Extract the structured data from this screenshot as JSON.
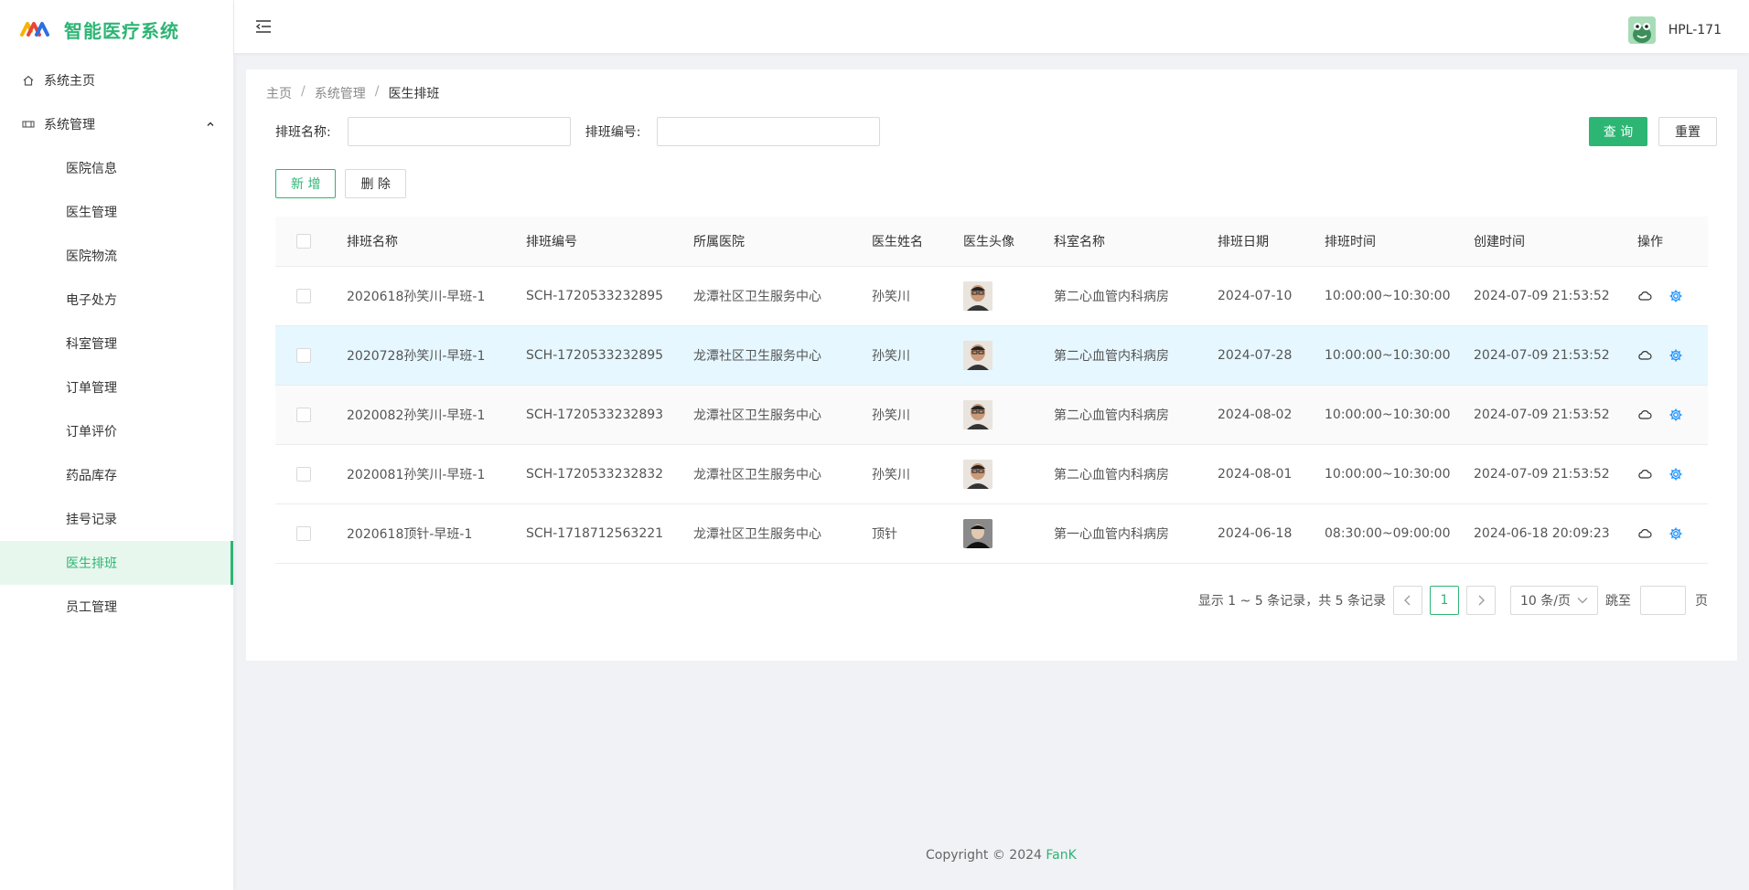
{
  "app": {
    "title": "智能医疗系统"
  },
  "sidebar": {
    "home": "系统主页",
    "group": "系统管理",
    "items": [
      {
        "label": "医院信息"
      },
      {
        "label": "医生管理"
      },
      {
        "label": "医院物流"
      },
      {
        "label": "电子处方"
      },
      {
        "label": "科室管理"
      },
      {
        "label": "订单管理"
      },
      {
        "label": "订单评价"
      },
      {
        "label": "药品库存"
      },
      {
        "label": "挂号记录"
      },
      {
        "label": "医生排班"
      },
      {
        "label": "员工管理"
      }
    ],
    "active": "医生排班"
  },
  "header": {
    "username": "HPL-171"
  },
  "breadcrumb": {
    "home": "主页",
    "section": "系统管理",
    "current": "医生排班",
    "sep": "/"
  },
  "search": {
    "name_label": "排班名称:",
    "code_label": "排班编号:",
    "name_value": "",
    "code_value": "",
    "query_btn": "查 询",
    "reset_btn": "重置"
  },
  "toolbar": {
    "add_btn": "新 增",
    "delete_btn": "删 除"
  },
  "table": {
    "columns": [
      "排班名称",
      "排班编号",
      "所属医院",
      "医生姓名",
      "医生头像",
      "科室名称",
      "排班日期",
      "排班时间",
      "创建时间",
      "操作"
    ],
    "rows": [
      {
        "name": "2020618孙笑川-早班-1",
        "code": "SCH-1720533232895",
        "hospital": "龙潭社区卫生服务中心",
        "doctor": "孙笑川",
        "dept": "第二心血管内科病房",
        "date": "2024-07-10",
        "time": "10:00:00~10:30:00",
        "created": "2024-07-09 21:53:52"
      },
      {
        "name": "2020728孙笑川-早班-1",
        "code": "SCH-1720533232895",
        "hospital": "龙潭社区卫生服务中心",
        "doctor": "孙笑川",
        "dept": "第二心血管内科病房",
        "date": "2024-07-28",
        "time": "10:00:00~10:30:00",
        "created": "2024-07-09 21:53:52"
      },
      {
        "name": "2020082孙笑川-早班-1",
        "code": "SCH-1720533232893",
        "hospital": "龙潭社区卫生服务中心",
        "doctor": "孙笑川",
        "dept": "第二心血管内科病房",
        "date": "2024-08-02",
        "time": "10:00:00~10:30:00",
        "created": "2024-07-09 21:53:52"
      },
      {
        "name": "2020081孙笑川-早班-1",
        "code": "SCH-1720533232832",
        "hospital": "龙潭社区卫生服务中心",
        "doctor": "孙笑川",
        "dept": "第二心血管内科病房",
        "date": "2024-08-01",
        "time": "10:00:00~10:30:00",
        "created": "2024-07-09 21:53:52"
      },
      {
        "name": "2020618顶针-早班-1",
        "code": "SCH-1718712563221",
        "hospital": "龙潭社区卫生服务中心",
        "doctor": "顶针",
        "dept": "第一心血管内科病房",
        "date": "2024-06-18",
        "time": "08:30:00~09:00:00",
        "created": "2024-06-18 20:09:23"
      }
    ]
  },
  "pager": {
    "total_text": "显示 1 ~ 5 条记录，共 5 条记录",
    "current_page": "1",
    "page_size": "10 条/页",
    "jump_label": "跳至",
    "page_suffix": "页"
  },
  "footer": {
    "copyright": "Copyright © 2024",
    "brand": "FanK"
  },
  "colors": {
    "accent": "#2db574",
    "highlight_row": "#e6f7ff"
  },
  "icons": [
    "home-icon",
    "settings-group-icon",
    "chevron-up-icon",
    "menu-fold-icon",
    "cloud-icon",
    "gear-icon",
    "chevron-left-icon",
    "chevron-right-icon",
    "chevron-down-icon"
  ]
}
